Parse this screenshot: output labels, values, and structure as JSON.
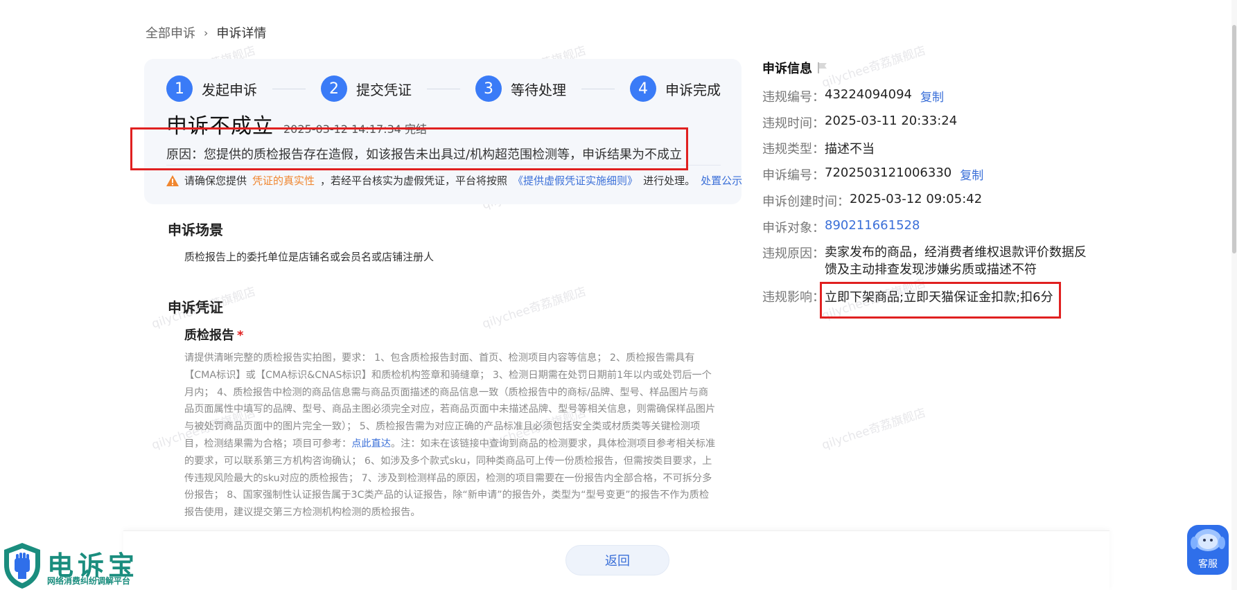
{
  "breadcrumb": {
    "root": "全部申诉",
    "separator": "›",
    "current": "申诉详情"
  },
  "steps": [
    {
      "num": "1",
      "label": "发起申诉"
    },
    {
      "num": "2",
      "label": "提交凭证"
    },
    {
      "num": "3",
      "label": "等待处理"
    },
    {
      "num": "4",
      "label": "申诉完成"
    }
  ],
  "result": {
    "title": "申诉不成立",
    "time": "2025-03-12 14:17:34 完结",
    "reason": "原因：您提供的质检报告存在造假，如该报告未出具过/机构超范围检测等，申诉结果为不成立"
  },
  "tip": {
    "prefix": "请确保您提供",
    "highlight": "凭证的真实性",
    "middle": "，若经平台核实为虚假凭证，平台将按照",
    "rule_link": "《提供虚假凭证实施细则》",
    "suffix": "进行处理。",
    "publicity_link": "处置公示"
  },
  "scene": {
    "title": "申诉场景",
    "text": "质检报告上的委托单位是店铺名或会员名或店铺注册人"
  },
  "evidence": {
    "title": "申诉凭证",
    "subtitle": "质检报告",
    "required_mark": "*",
    "req_part1": "请提供清晰完整的质检报告实拍图，要求： 1、包含质检报告封面、首页、检测项目内容等信息； 2、质检报告需具有【CMA标识】或【CMA标识&CNAS标识】和质检机构签章和骑缝章； 3、检测日期需在处罚日期前1年以内或处罚后一个月内； 4、质检报告中检测的商品信息需与商品页面描述的商品信息一致（质检报告中的商标/品牌、型号、样品图片与商品页面属性中填写的品牌、型号、商品主图必须完全对应，若商品页面中未描述品牌、型号等相关信息，则需确保样品图片与被处罚商品页面中的图片完全一致）； 5、质检报告需为对应正确的产品标准且必须包括安全类或材质类等关键检测项目，检测结果需为合格；项目可参考：",
    "req_link": "点此直达",
    "req_part2": "。注：如未在该链接中查询到商品的检测要求，具体检测项目参考相关标准的要求，可以联系第三方机构咨询确认； 6、如涉及多个款式sku，同种类商品可上传一份质检报告，但需按类目要求，上传违规风险最大的sku对应的质检报告； 7、涉及到检测样品的原因，检测的项目需要在一份报告内全部合格，不可拆分多份报告； 8、国家强制性认证报告属于3C类产品的认证报告，除“新申请”的报告外，类型为“型号变更”的报告不作为质检报告使用，建议提交第三方检测机构检测的质检报告。"
  },
  "info": {
    "header": "申诉信息",
    "violation_no_label": "违规编号：",
    "violation_no": "43224094094",
    "copy_label": "复制",
    "violation_time_label": "违规时间：",
    "violation_time": "2025-03-11 20:33:24",
    "violation_type_label": "违规类型：",
    "violation_type": "描述不当",
    "appeal_no_label": "申诉编号：",
    "appeal_no": "7202503121006330",
    "appeal_created_label": "申诉创建时间：",
    "appeal_created": "2025-03-12 09:05:42",
    "appeal_target_label": "申诉对象：",
    "appeal_target": "890211661528",
    "violation_reason_label": "违规原因：",
    "violation_reason": "卖家发布的商品，经消费者维权退款评价数据反馈及主动排查发现涉嫌劣质或描述不符",
    "violation_impact_label": "违规影响：",
    "violation_impact": "立即下架商品;立即天猫保证金扣款;扣6分"
  },
  "watermark_text": "qilychee奇荔旗舰店",
  "footer": {
    "back_label": "返回"
  },
  "logo": {
    "name": "电诉宝",
    "slogan": "网络消费纠纷调解平台"
  },
  "customer_service": {
    "label": "客服"
  },
  "colors": {
    "accent": "#3a7bf7",
    "highlight_box": "#e02020",
    "link": "#3a6fd8",
    "warning": "#f0862f",
    "logo_green": "#1a8d7e"
  }
}
